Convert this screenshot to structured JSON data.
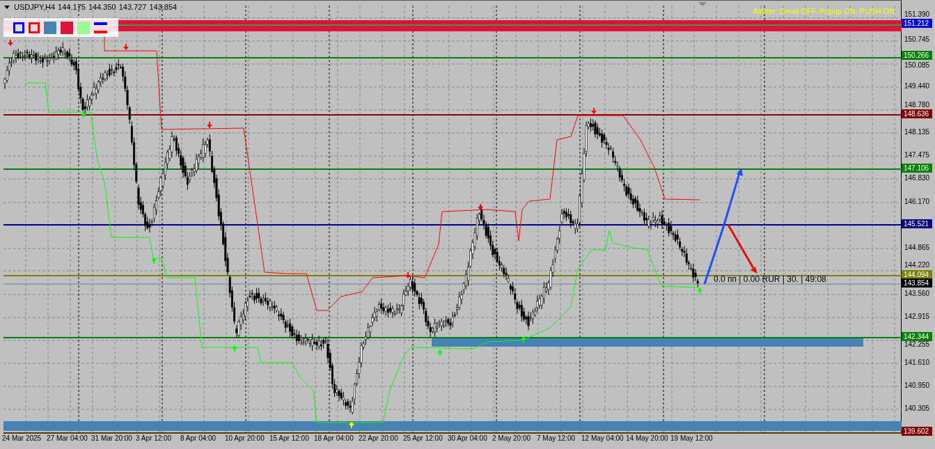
{
  "chart": {
    "symbol": "USDJPY,H4",
    "ohlc": [
      "144.175",
      "144.350",
      "143.727",
      "143.854"
    ],
    "alerter": "Alerter: Email OFF.  Popup ON.  PUSH ON.",
    "price_ticks": [
      "151.390",
      "150.745",
      "150.085",
      "149.440",
      "148.780",
      "148.135",
      "147.475",
      "146.830",
      "146.170",
      "144.865",
      "144.220",
      "143.560",
      "142.915",
      "142.255",
      "141.610",
      "140.950",
      "140.305"
    ],
    "level_tags": [
      {
        "price": "151.212",
        "color": "#0000cc"
      },
      {
        "price": "150.266",
        "color": "#008000"
      },
      {
        "price": "148.636",
        "color": "#800000"
      },
      {
        "price": "147.106",
        "color": "#008000"
      },
      {
        "price": "145.521",
        "color": "#000080"
      },
      {
        "price": "144.094",
        "color": "#808000"
      },
      {
        "price": "143.854",
        "color": "#000000"
      },
      {
        "price": "142.344",
        "color": "#008000"
      },
      {
        "price": "139.602",
        "color": "#800000"
      }
    ],
    "time_labels": [
      "24 Mar 2025",
      "27 Mar 04:00",
      "31 Mar 20:00",
      "3 Apr 12:00",
      "8 Apr 04:00",
      "10 Apr 20:00",
      "15 Apr 12:00",
      "18 Apr 04:00",
      "22 Apr 20:00",
      "25 Apr 12:00",
      "30 Apr 04:00",
      "2 May 20:00",
      "7 May 12:00",
      "12 May 04:00",
      "14 May 20:00",
      "19 May 12:00"
    ],
    "info_text": "0.0 пп | 0.00 RUR | 30. | 49:08"
  }
}
